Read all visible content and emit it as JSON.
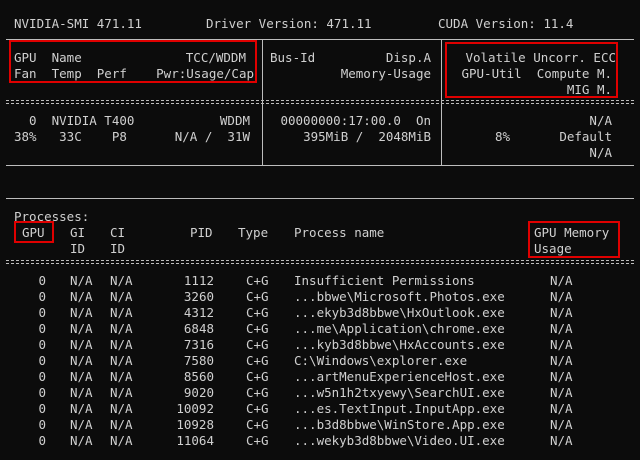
{
  "header": {
    "smi": "NVIDIA-SMI 471.11",
    "driver": "Driver Version: 471.11",
    "cuda": "CUDA Version: 11.4"
  },
  "gpu_table": {
    "col1_h1": "GPU  Name",
    "col1_h1r": "TCC/WDDM",
    "col1_h2": "Fan  Temp  Perf",
    "col1_h2r": "Pwr:Usage/Cap",
    "col2_h1l": "Bus-Id",
    "col2_h1r": "Disp.A",
    "col2_h2r": "Memory-Usage",
    "col3_h1": "Volatile Uncorr. ECC",
    "col3_h2": "GPU-Util  Compute M.",
    "col3_h3": "MIG M.",
    "row1_c1": "  0  NVIDIA T400",
    "row1_c1r": "WDDM",
    "row2_c1": "38%   33C    P8",
    "row2_c1r": "N/A /  31W",
    "row1_c2": "00000000:17:00.0  On",
    "row2_c2": "395MiB /  2048MiB",
    "row1_c3": "N/A",
    "row2_c3a": "8%",
    "row2_c3b": "Default",
    "row3_c3": "N/A"
  },
  "processes": {
    "title": "Processes:",
    "headers": {
      "gpu": "GPU",
      "gi_1": "GI",
      "gi_2": "ID",
      "ci_1": "CI",
      "ci_2": "ID",
      "pid": "PID",
      "type": "Type",
      "name": "Process name",
      "mem_1": "GPU Memory",
      "mem_2": "Usage"
    },
    "rows": [
      {
        "gpu": "0",
        "gi": "N/A",
        "ci": "N/A",
        "pid": "1112",
        "type": "C+G",
        "name": "Insufficient Permissions",
        "mem": "N/A"
      },
      {
        "gpu": "0",
        "gi": "N/A",
        "ci": "N/A",
        "pid": "3260",
        "type": "C+G",
        "name": "...bbwe\\Microsoft.Photos.exe",
        "mem": "N/A"
      },
      {
        "gpu": "0",
        "gi": "N/A",
        "ci": "N/A",
        "pid": "4312",
        "type": "C+G",
        "name": "...ekyb3d8bbwe\\HxOutlook.exe",
        "mem": "N/A"
      },
      {
        "gpu": "0",
        "gi": "N/A",
        "ci": "N/A",
        "pid": "6848",
        "type": "C+G",
        "name": "...me\\Application\\chrome.exe",
        "mem": "N/A"
      },
      {
        "gpu": "0",
        "gi": "N/A",
        "ci": "N/A",
        "pid": "7316",
        "type": "C+G",
        "name": "...kyb3d8bbwe\\HxAccounts.exe",
        "mem": "N/A"
      },
      {
        "gpu": "0",
        "gi": "N/A",
        "ci": "N/A",
        "pid": "7580",
        "type": "C+G",
        "name": "C:\\Windows\\explorer.exe",
        "mem": "N/A"
      },
      {
        "gpu": "0",
        "gi": "N/A",
        "ci": "N/A",
        "pid": "8560",
        "type": "C+G",
        "name": "...artMenuExperienceHost.exe",
        "mem": "N/A"
      },
      {
        "gpu": "0",
        "gi": "N/A",
        "ci": "N/A",
        "pid": "9020",
        "type": "C+G",
        "name": "...w5n1h2txyewy\\SearchUI.exe",
        "mem": "N/A"
      },
      {
        "gpu": "0",
        "gi": "N/A",
        "ci": "N/A",
        "pid": "10092",
        "type": "C+G",
        "name": "...es.TextInput.InputApp.exe",
        "mem": "N/A"
      },
      {
        "gpu": "0",
        "gi": "N/A",
        "ci": "N/A",
        "pid": "10928",
        "type": "C+G",
        "name": "...b3d8bbwe\\WinStore.App.exe",
        "mem": "N/A"
      },
      {
        "gpu": "0",
        "gi": "N/A",
        "ci": "N/A",
        "pid": "11064",
        "type": "C+G",
        "name": "...wekyb3d8bbwe\\Video.UI.exe",
        "mem": "N/A"
      }
    ]
  }
}
